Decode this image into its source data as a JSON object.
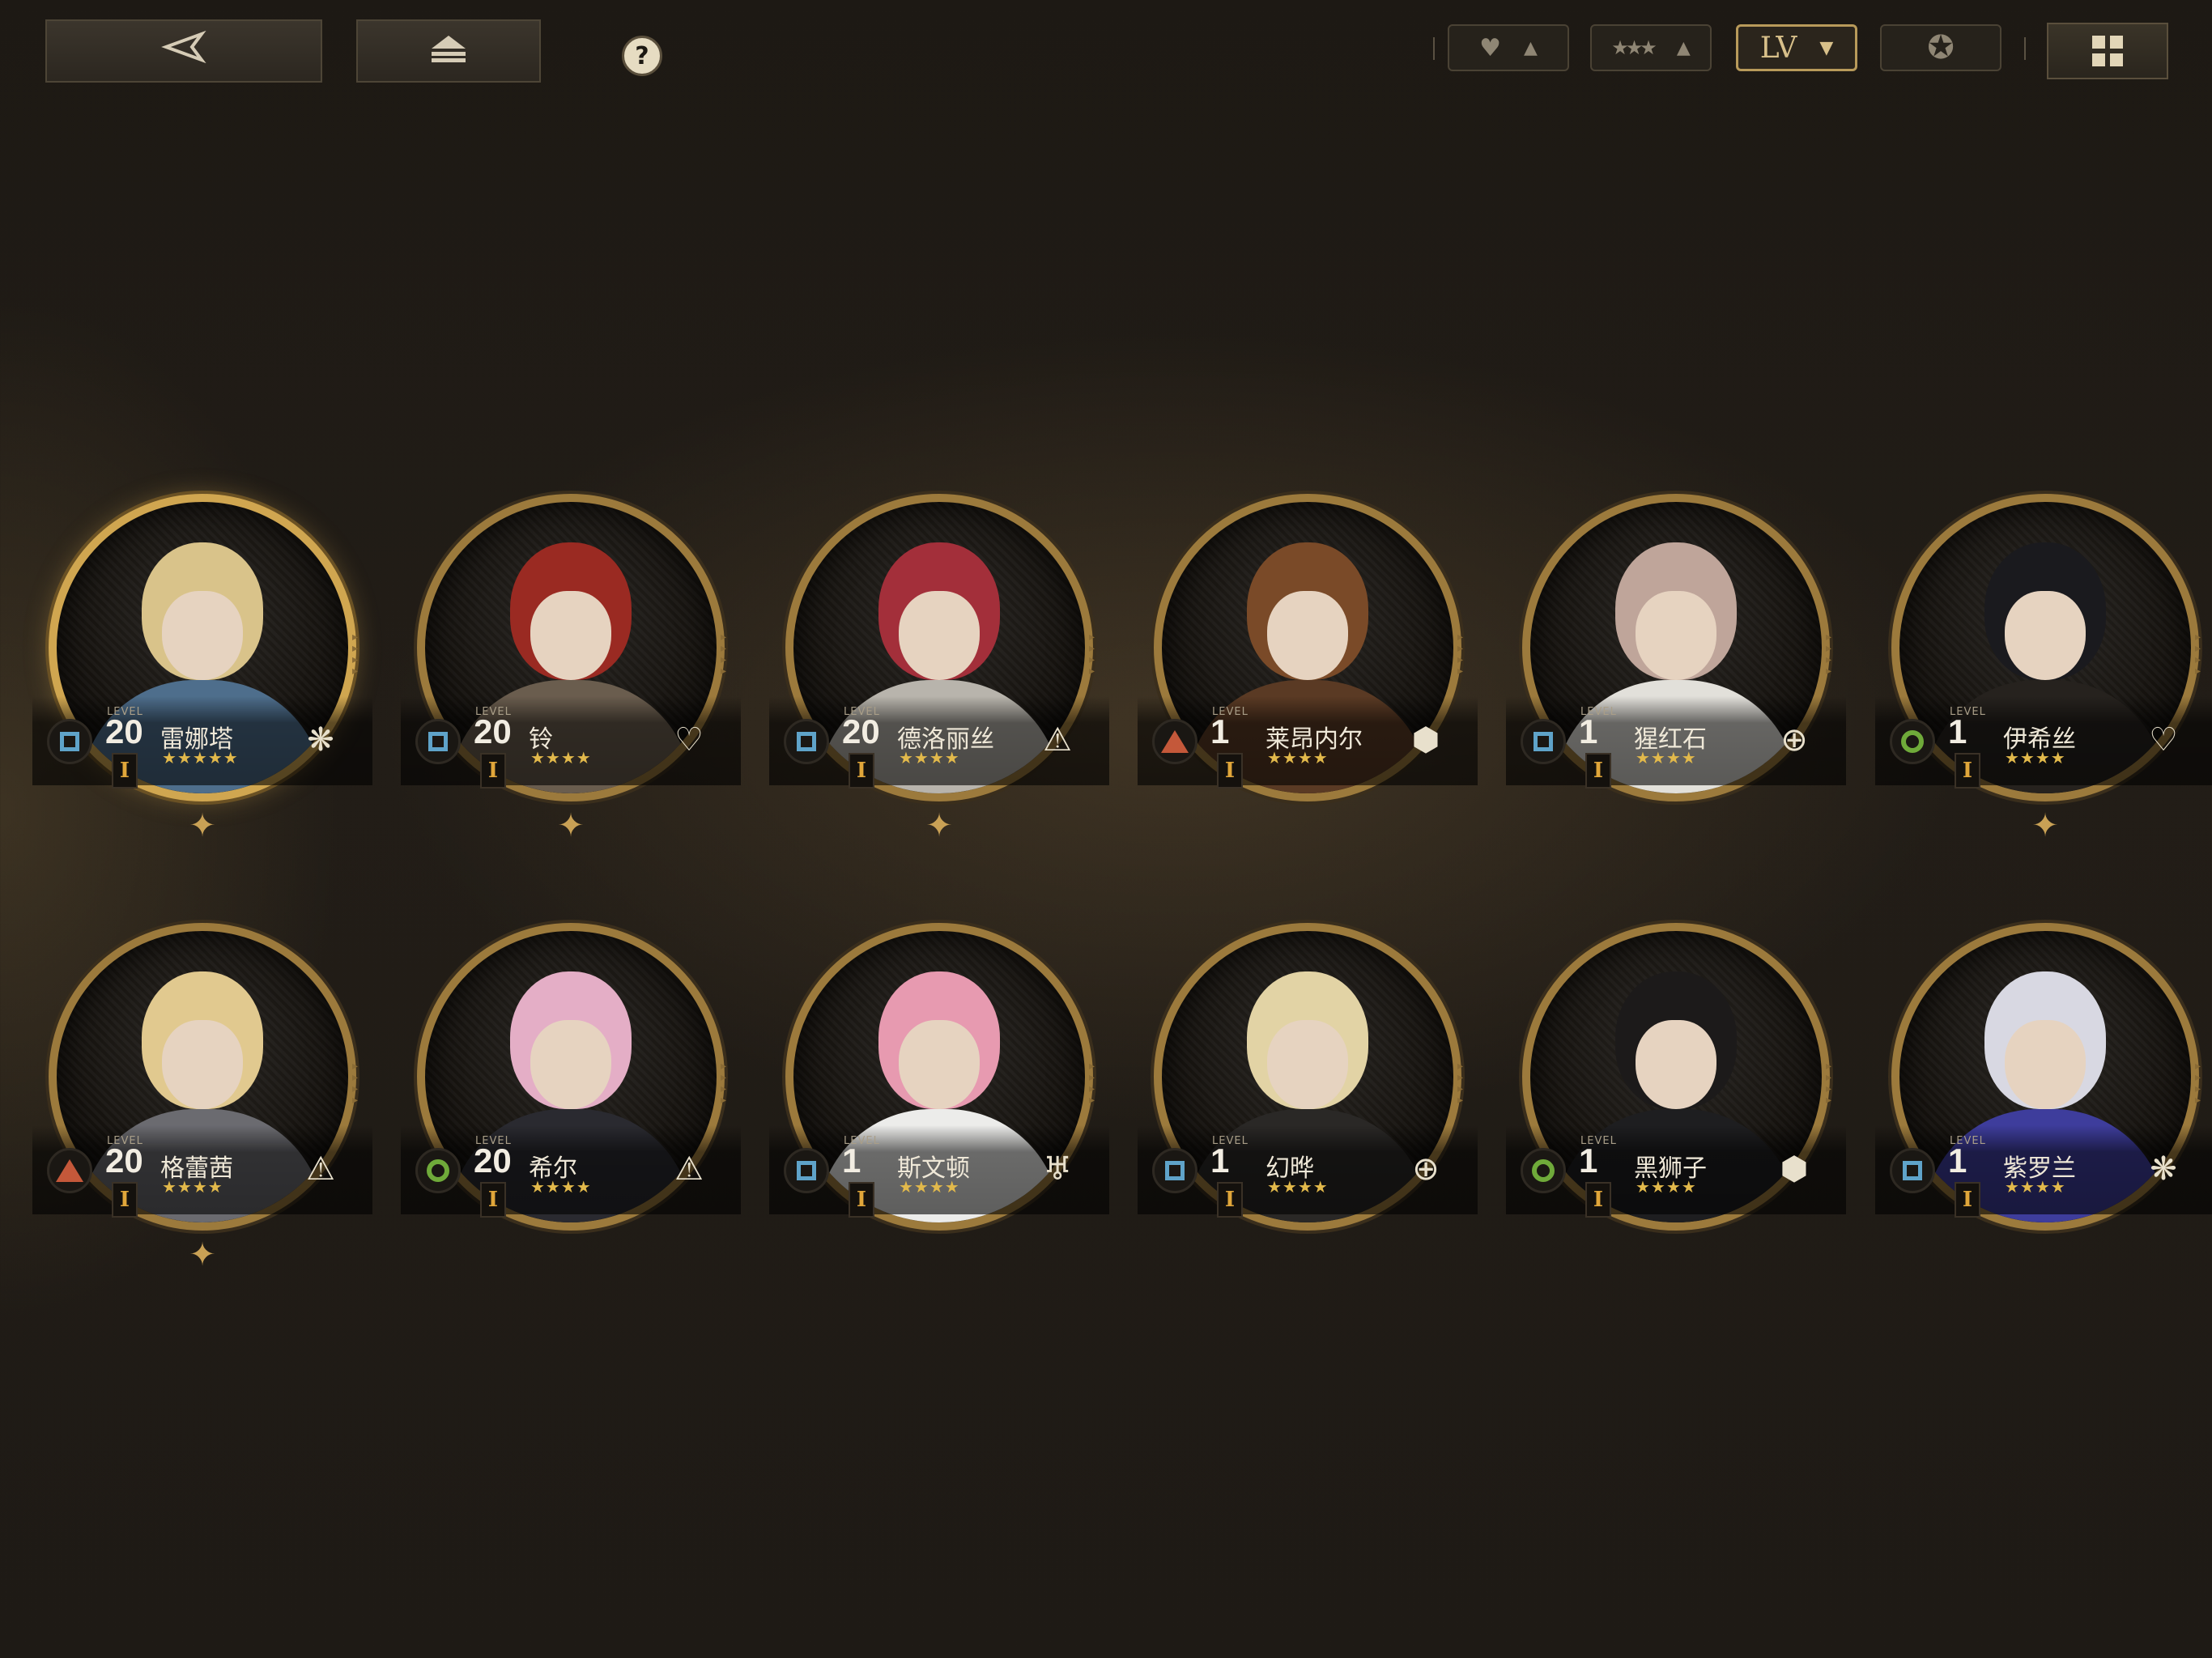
{
  "toolbar": {
    "back_icon": "back-arrow-icon",
    "home_icon": "eject-icon",
    "help_label": "?",
    "sort_buttons": [
      {
        "icon": "heart-icon",
        "label": "♥",
        "arrow": "▲"
      },
      {
        "icon": "stars-icon",
        "label": "★★★",
        "arrow": "▲"
      },
      {
        "icon": "level-icon",
        "label": "LV",
        "arrow": "▼",
        "active": true
      },
      {
        "icon": "emblem-icon",
        "label": "✪",
        "arrow": ""
      }
    ],
    "view_icon": "grid-view-icon"
  },
  "level_caption": "LEVEL",
  "characters": [
    {
      "name": "雷娜塔",
      "level": "20",
      "stars": "★★★★★",
      "rank": "I",
      "class": "square",
      "role_icon": "snowflake-emblem-icon",
      "role_glyph": "❋",
      "hair": "#d9c38a",
      "body": "#4e6e8c",
      "gold": true
    },
    {
      "name": "铃",
      "level": "20",
      "stars": "★★★★",
      "rank": "I",
      "class": "square",
      "role_icon": "heart-emblem-icon",
      "role_glyph": "♡",
      "hair": "#9a2a22",
      "body": "#6a5d4e",
      "gold": false
    },
    {
      "name": "德洛丽丝",
      "level": "20",
      "stars": "★★★★",
      "rank": "I",
      "class": "square",
      "role_icon": "tent-emblem-icon",
      "role_glyph": "⚠",
      "hair": "#a32f3a",
      "body": "#b8b4ac",
      "gold": false
    },
    {
      "name": "莱昂内尔",
      "level": "1",
      "stars": "★★★★",
      "rank": "I",
      "class": "triangle",
      "role_icon": "hexagon-emblem-icon",
      "role_glyph": "⬢",
      "hair": "#7a4a28",
      "body": "#5a3a24",
      "gold": false
    },
    {
      "name": "猩红石",
      "level": "1",
      "stars": "★★★★",
      "rank": "I",
      "class": "square",
      "role_icon": "crosshair-emblem-icon",
      "role_glyph": "⊕",
      "hair": "#bfa59a",
      "body": "#e2e0da",
      "gold": false
    },
    {
      "name": "伊希丝",
      "level": "1",
      "stars": "★★★★",
      "rank": "I",
      "class": "circle",
      "role_icon": "heart-emblem-icon",
      "role_glyph": "♡",
      "hair": "#1a1a1e",
      "body": "#26221e",
      "gold": false
    },
    {
      "name": "格蕾茜",
      "level": "20",
      "stars": "★★★★",
      "rank": "I",
      "class": "triangle",
      "role_icon": "tent-emblem-icon",
      "role_glyph": "⚠",
      "hair": "#e1c98f",
      "body": "#6b6b70",
      "gold": false
    },
    {
      "name": "希尔",
      "level": "20",
      "stars": "★★★★",
      "rank": "I",
      "class": "circle",
      "role_icon": "tent-emblem-icon",
      "role_glyph": "⚠",
      "hair": "#e4aec6",
      "body": "#2a2a30",
      "gold": false
    },
    {
      "name": "斯文顿",
      "level": "1",
      "stars": "★★★★",
      "rank": "I",
      "class": "square",
      "role_icon": "wings-emblem-icon",
      "role_glyph": "♅",
      "hair": "#e79ab0",
      "body": "#ececea",
      "gold": false
    },
    {
      "name": "幻晔",
      "level": "1",
      "stars": "★★★★",
      "rank": "I",
      "class": "square",
      "role_icon": "crosshair-emblem-icon",
      "role_glyph": "⊕",
      "hair": "#e2d3a5",
      "body": "#2a2826",
      "gold": false
    },
    {
      "name": "黑狮子",
      "level": "1",
      "stars": "★★★★",
      "rank": "I",
      "class": "circle",
      "role_icon": "hexagon-emblem-icon",
      "role_glyph": "⬢",
      "hair": "#1c1a1a",
      "body": "#1e1e20",
      "gold": false
    },
    {
      "name": "紫罗兰",
      "level": "1",
      "stars": "★★★★",
      "rank": "I",
      "class": "square",
      "role_icon": "snowflake-emblem-icon",
      "role_glyph": "❋",
      "hair": "#d8d8e2",
      "body": "#3e3d9c",
      "gold": false
    }
  ]
}
